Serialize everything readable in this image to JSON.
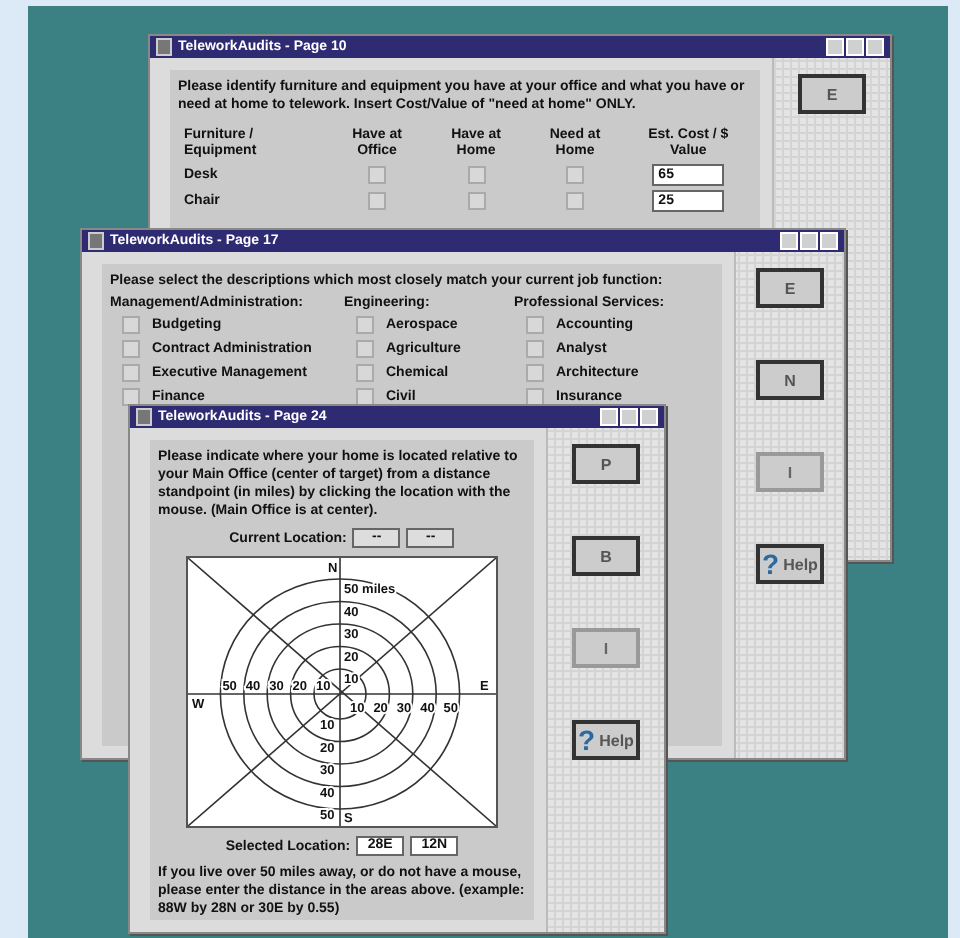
{
  "windows": [
    {
      "title": "TeleworkAudits - Page 10",
      "kind": "furniture",
      "instructions": "Please identify furniture and equipment you have at your office and what you have or need at home to telework.  Insert Cost/Value of \"need at home\" ONLY.",
      "columns": [
        "Furniture / Equipment",
        "Have at Office",
        "Have at Home",
        "Need at Home",
        "Est. Cost / $ Value"
      ],
      "rows": [
        {
          "item": "Desk",
          "have_office": false,
          "have_home": false,
          "need_home": false,
          "value": "65"
        },
        {
          "item": "Chair",
          "have_office": false,
          "have_home": false,
          "need_home": false,
          "value": "25"
        }
      ],
      "buttons": [
        {
          "label": "E",
          "disabled": false
        }
      ]
    },
    {
      "title": "TeleworkAudits - Page 17",
      "kind": "job",
      "instructions": "Please select the descriptions which most closely match your current job function:",
      "groups": [
        {
          "heading": "Management/Administration:",
          "options": [
            {
              "label": "Budgeting",
              "checked": false
            },
            {
              "label": "Contract Administration",
              "checked": false
            },
            {
              "label": "Executive Management",
              "checked": false
            },
            {
              "label": "Finance",
              "checked": false
            }
          ]
        },
        {
          "heading": "Engineering:",
          "options": [
            {
              "label": "Aerospace",
              "checked": false
            },
            {
              "label": "Agriculture",
              "checked": false
            },
            {
              "label": "Chemical",
              "checked": false
            },
            {
              "label": "Civil",
              "checked": false
            }
          ]
        },
        {
          "heading": "Professional Services:",
          "options": [
            {
              "label": "Accounting",
              "checked": false
            },
            {
              "label": "Analyst",
              "checked": false
            },
            {
              "label": "Architecture",
              "checked": false
            },
            {
              "label": "Insurance",
              "checked": false
            }
          ]
        }
      ],
      "buttons": [
        {
          "label": "E",
          "disabled": false
        },
        {
          "label": "N",
          "disabled": false
        },
        {
          "label": "I",
          "disabled": true
        },
        {
          "label": "Help",
          "icon": "?",
          "disabled": false
        }
      ]
    },
    {
      "title": "TeleworkAudits - Page 24",
      "kind": "location",
      "instructions": "Please indicate where your home is located relative to your Main Office (center of target) from a distance standpoint (in miles) by clicking the location with the mouse.    (Main Office is at center).",
      "current_location": {
        "label": "Current Location:",
        "fields": [
          "--",
          "--"
        ]
      },
      "target": {
        "north": "N",
        "south": "S",
        "east": "E",
        "west": "W",
        "north_labels": [
          "50 miles",
          "40",
          "30",
          "20",
          "10"
        ],
        "west_labels": [
          "50",
          "40",
          "30",
          "20",
          "10"
        ],
        "east_labels": [
          "10",
          "20",
          "30",
          "40",
          "50"
        ],
        "south_labels": [
          "10",
          "20",
          "30",
          "40",
          "50"
        ]
      },
      "selected_location": {
        "label": "Selected Location:",
        "fields": [
          "28E",
          "12N"
        ]
      },
      "note": "If you live over 50 miles away, or do not have a mouse, please enter the distance in the areas above.    (example:   88W by 28N or 30E by 0.55)",
      "buttons": [
        {
          "label": "P",
          "disabled": false
        },
        {
          "label": "B",
          "disabled": false
        },
        {
          "label": "I",
          "disabled": true
        },
        {
          "label": "Help",
          "icon": "?",
          "disabled": false
        }
      ]
    }
  ]
}
